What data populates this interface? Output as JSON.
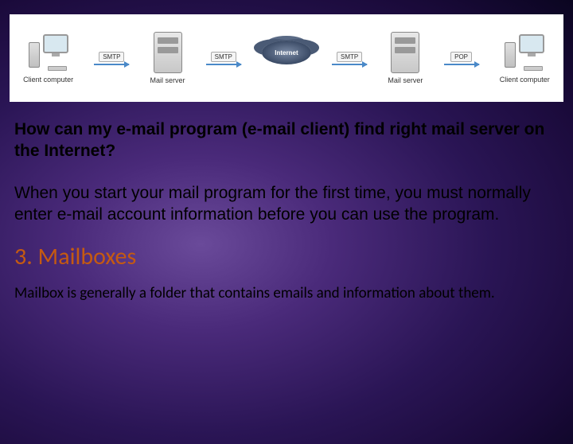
{
  "diagram": {
    "nodes": [
      {
        "label": "Client computer"
      },
      {
        "label": "Mail server"
      },
      {
        "label": "Internet"
      },
      {
        "label": "Mail server"
      },
      {
        "label": "Client computer"
      }
    ],
    "arrows": [
      {
        "label": "SMTP"
      },
      {
        "label": "SMTP"
      },
      {
        "label": "SMTP"
      },
      {
        "label": "POP"
      }
    ]
  },
  "question": "How can my e-mail program (e-mail client) find right mail server on the Internet?",
  "answer": "When you start your mail program for the first time, you must normally enter e-mail account information before you can use the program.",
  "section": {
    "title": "3. Mailboxes",
    "body": "Mailbox is generally a folder that contains emails and information about them."
  }
}
